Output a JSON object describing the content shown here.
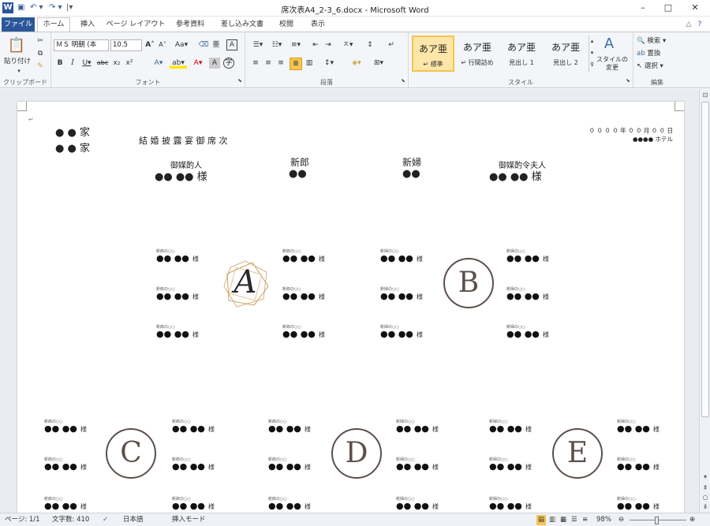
{
  "titlebar": {
    "logo": "W",
    "title": "席次表A4_2-3_6.docx - Microsoft Word",
    "minimize": "–",
    "maximize": "□",
    "close": "✕"
  },
  "tabs": {
    "file": "ファイル",
    "items": [
      "ホーム",
      "挿入",
      "ページ レイアウト",
      "参考資料",
      "差し込み文書",
      "校閲",
      "表示"
    ]
  },
  "ribbon": {
    "clipboard": {
      "paste": "貼り付け",
      "label": "クリップボード"
    },
    "font": {
      "name": "ＭＳ 明朝 (本",
      "size": "10.5",
      "label": "フォント"
    },
    "paragraph": {
      "label": "段落"
    },
    "styles": {
      "label": "スタイル",
      "items": [
        {
          "sample": "あア亜",
          "name": "↵ 標準"
        },
        {
          "sample": "あア亜",
          "name": "↵ 行間詰め"
        },
        {
          "sample": "あア亜",
          "name": "見出し 1"
        },
        {
          "sample": "あア亜",
          "name": "見出し 2"
        }
      ],
      "change": "スタイルの変更"
    },
    "editing": {
      "label": "編集",
      "find": "検索",
      "replace": "置換",
      "select": "選択"
    }
  },
  "document": {
    "families": [
      "● ● 家",
      "● ● 家"
    ],
    "heading": "結 婚 披 露 宴 御 席 次",
    "date": "０ ０ ０ ０ 年 ０ ０ 月 ０ ０ 日",
    "venue": "●●●● ホテル",
    "hosts": [
      {
        "role": "御媒酌人",
        "names": "●●  ●●  様"
      },
      {
        "role": "新郎",
        "names": "●●"
      },
      {
        "role": "新婦",
        "names": "●●"
      },
      {
        "role": "御媒酌令夫人",
        "names": "●●  ●●  様"
      }
    ],
    "guest": {
      "title_groom": "新郎の○○",
      "title_bride": "新婦の○○",
      "name": "●● ●●",
      "honorific": "様"
    },
    "tables": [
      "A",
      "B",
      "C",
      "D",
      "E"
    ]
  },
  "statusbar": {
    "page": "ページ: 1/1",
    "words": "文字数: 410",
    "lang": "日本語",
    "mode": "挿入モード",
    "zoom": "98%"
  }
}
